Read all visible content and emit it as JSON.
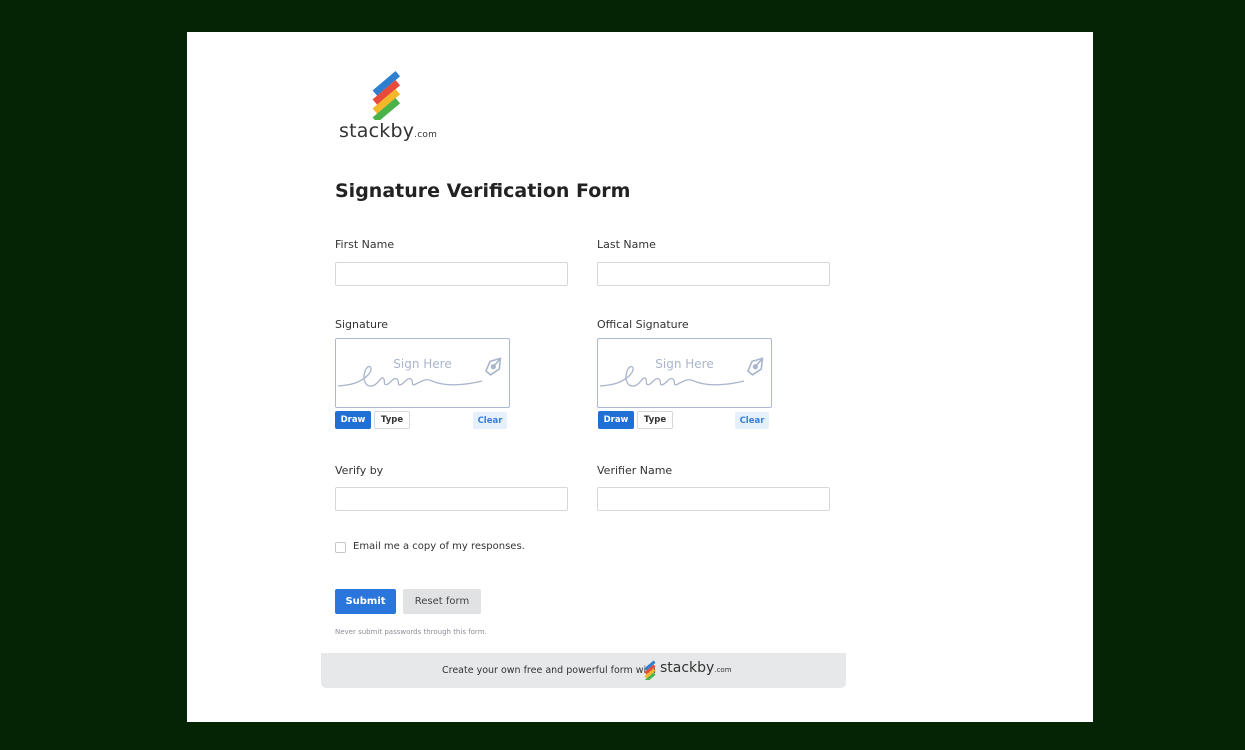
{
  "brand": {
    "name": "stackby",
    "domain": ".com",
    "colors": [
      "#2f7fd1",
      "#e84b3c",
      "#f5b72a",
      "#49b34a"
    ]
  },
  "form": {
    "title": "Signature Verification Form",
    "fields": {
      "first_name": {
        "label": "First Name",
        "value": ""
      },
      "last_name": {
        "label": "Last Name",
        "value": ""
      },
      "verify_by": {
        "label": "Verify by",
        "value": ""
      },
      "verifier_name": {
        "label": "Verifier Name",
        "value": ""
      }
    },
    "signatures": [
      {
        "label": "Signature",
        "placeholder": "Sign Here",
        "draw": "Draw",
        "type": "Type",
        "clear": "Clear"
      },
      {
        "label": "Offical Signature",
        "placeholder": "Sign Here",
        "draw": "Draw",
        "type": "Type",
        "clear": "Clear"
      }
    ],
    "email_copy_label": "Email me a copy of my responses.",
    "email_copy_checked": false,
    "submit_label": "Submit",
    "reset_label": "Reset form",
    "note": "Never submit passwords through this form."
  },
  "footer": {
    "text": "Create your own free and powerful form with",
    "logo_name": "stackby",
    "logo_domain": ".com"
  },
  "colors": {
    "page_bg": "#052305",
    "accent": "#2a76dc",
    "card_bg": "#ffffff"
  }
}
